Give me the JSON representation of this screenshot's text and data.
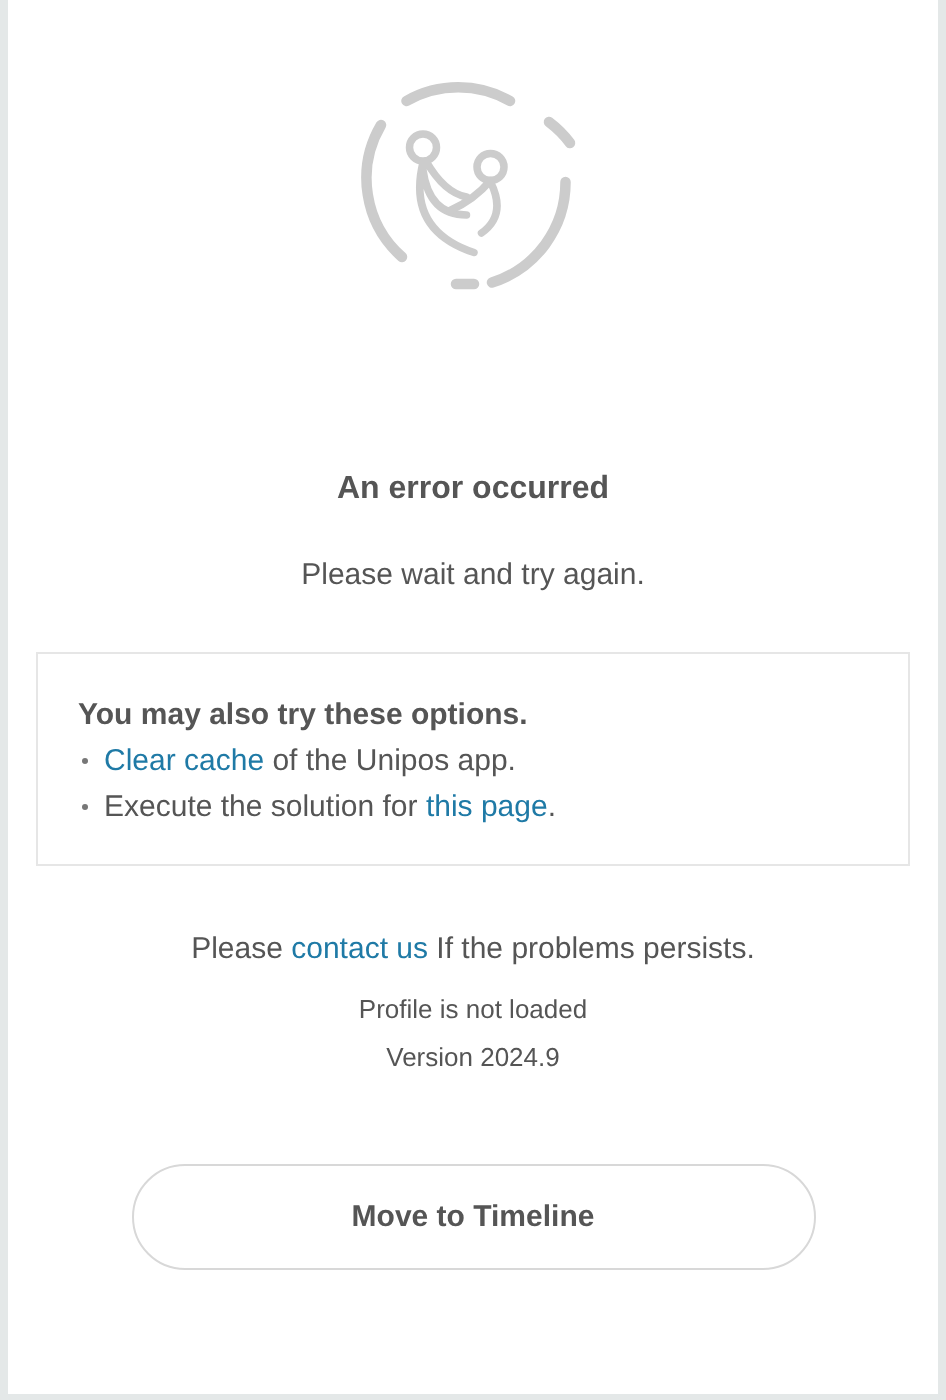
{
  "title": "An error occurred",
  "message": "Please wait and try again.",
  "options": {
    "heading": "You may also try these options.",
    "items": [
      {
        "parts": [
          {
            "kind": "link",
            "text": "Clear cache"
          },
          {
            "kind": "text",
            "text": " of the Unipos app."
          }
        ]
      },
      {
        "parts": [
          {
            "kind": "text",
            "text": "Execute the solution for "
          },
          {
            "kind": "link",
            "text": "this page"
          },
          {
            "kind": "text",
            "text": "."
          }
        ]
      }
    ]
  },
  "contact": {
    "parts": [
      {
        "kind": "text",
        "text": "Please "
      },
      {
        "kind": "link",
        "text": "contact us"
      },
      {
        "kind": "text",
        "text": " If the problems persists."
      }
    ]
  },
  "details": [
    "Profile is not loaded",
    "Version 2024.9"
  ],
  "button": "Move to Timeline"
}
